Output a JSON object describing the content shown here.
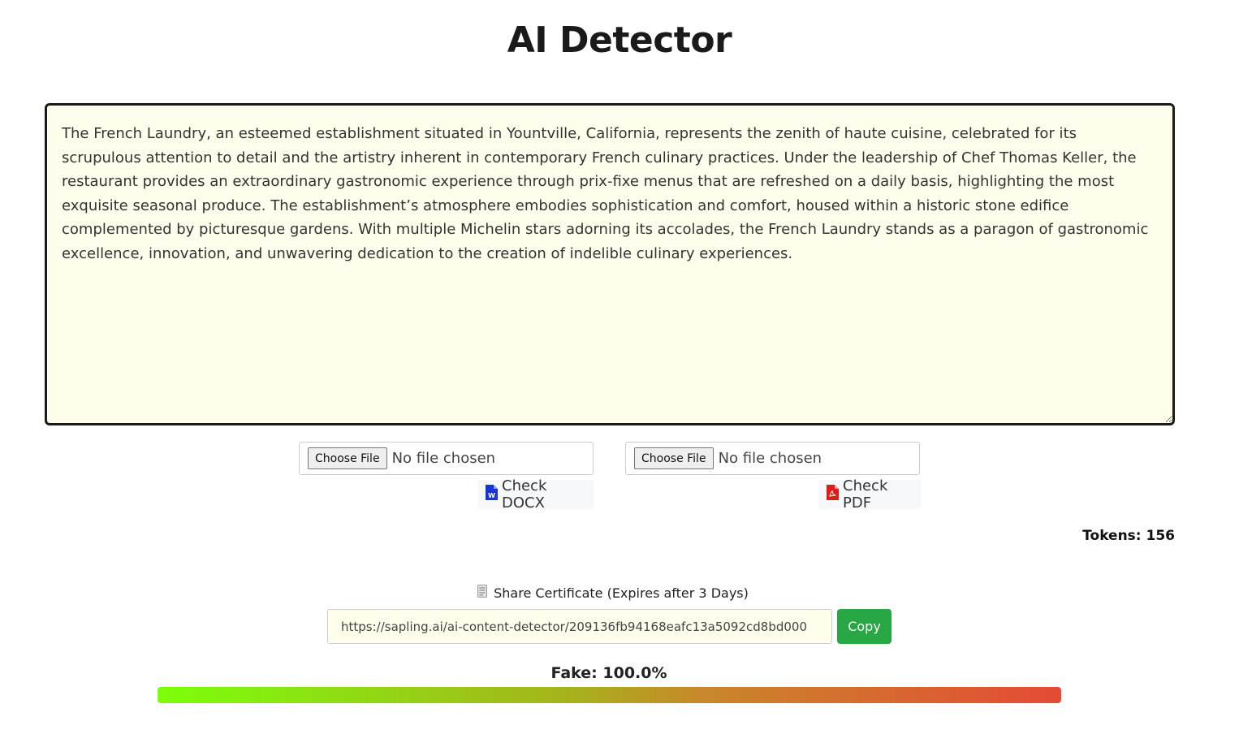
{
  "page": {
    "title": "AI Detector"
  },
  "editor": {
    "text": "The French Laundry, an esteemed establishment situated in Yountville, California, represents the zenith of haute cuisine, celebrated for its scrupulous attention to detail and the artistry inherent in contemporary French culinary practices. Under the leadership of Chef Thomas Keller, the restaurant provides an extraordinary gastronomic experience through prix-fixe menus that are refreshed on a daily basis, highlighting the most exquisite seasonal produce. The establishment’s atmosphere embodies sophistication and comfort, housed within a historic stone edifice complemented by picturesque gardens. With multiple Michelin stars adorning its accolades, the French Laundry stands as a paragon of gastronomic excellence, innovation, and unwavering dedication to the creation of indelible culinary experiences."
  },
  "uploads": {
    "docx": {
      "choose_label": "Choose File",
      "status": "No file chosen",
      "check_label": "Check DOCX",
      "icon": "word-file-icon",
      "icon_color": "#1a35d6"
    },
    "pdf": {
      "choose_label": "Choose File",
      "status": "No file chosen",
      "check_label": "Check PDF",
      "icon": "pdf-file-icon",
      "icon_color": "#e01b1b"
    }
  },
  "tokens": {
    "label": "Tokens: 156"
  },
  "share": {
    "icon": "certificate-icon",
    "label": "Share Certificate (Expires after 3 Days)",
    "url": "https://sapling.ai/ai-content-detector/209136fb94168eafc13a5092cd8bd000",
    "copy_label": "Copy",
    "copy_color": "#28a745"
  },
  "score": {
    "label": "Fake: 100.0%",
    "fraction": 1.0
  }
}
